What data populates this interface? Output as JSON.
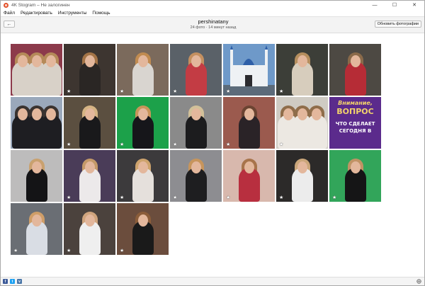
{
  "window": {
    "title": "4K Stogram – Не залогинен",
    "controls": [
      "—",
      "☐",
      "✕"
    ]
  },
  "menu": [
    "Файл",
    "Редактировать",
    "Инструменты",
    "Помощь"
  ],
  "header": {
    "back_label": "←",
    "username": "pershinatany",
    "subtitle": "24 фото · 14 минут назад",
    "update_button": "Обновить фотографии"
  },
  "photos": [
    {
      "bg": "#8c3a4b",
      "body": "#d8d1c8",
      "hair": "#b58a59",
      "star": false,
      "group": true
    },
    {
      "bg": "#3d3530",
      "body": "#2a2624",
      "hair": "#a47447",
      "star": true
    },
    {
      "bg": "#7b6a5c",
      "body": "#d9d5d0",
      "hair": "#c18b50",
      "star": true
    },
    {
      "bg": "#5a6168",
      "body": "#c33c44",
      "hair": "#c49060",
      "star": true
    },
    {
      "bg": "#6e99c9",
      "body": "#eaeef2",
      "hair": "#3f4650",
      "star": true,
      "mosque": true
    },
    {
      "bg": "#3c3e38",
      "body": "#d7cdbd",
      "hair": "#b58e5e",
      "star": true
    },
    {
      "bg": "#4d4943",
      "body": "#b62c36",
      "hair": "#8a6a4a",
      "star": false
    },
    {
      "bg": "#9aa8bb",
      "body": "#1e1e22",
      "hair": "#3a3330",
      "star": false,
      "group": true
    },
    {
      "bg": "#5b4f40",
      "body": "#19191b",
      "hair": "#d5b484",
      "star": true
    },
    {
      "bg": "#1ca14a",
      "body": "#16161a",
      "hair": "#c7955a",
      "star": true
    },
    {
      "bg": "#8a8a8a",
      "body": "#1c1c1e",
      "hair": "#d2c099",
      "star": true
    },
    {
      "bg": "#9b5a4e",
      "body": "#2a2327",
      "hair": "#6b4432",
      "star": true
    },
    {
      "bg": "#cfcbc3",
      "body": "#ece8e2",
      "hair": "#8f6d4a",
      "star": true,
      "group": true
    },
    {
      "bg": "#5b2b8c",
      "body": "#5b2b8c",
      "hair": "#5b2b8c",
      "star": false,
      "text": true
    },
    {
      "bg": "#bdbcbc",
      "body": "#141416",
      "hair": "#c9a16f",
      "star": false
    },
    {
      "bg": "#4a3c58",
      "body": "#ece9ea",
      "hair": "#c49968",
      "star": true
    },
    {
      "bg": "#3c3a3c",
      "body": "#e5e0dc",
      "hair": "#cda36d",
      "star": true
    },
    {
      "bg": "#8d8d91",
      "body": "#1e1e20",
      "hair": "#c7955c",
      "star": true
    },
    {
      "bg": "#d8b8ad",
      "body": "#b82f3f",
      "hair": "#a8744b",
      "star": true
    },
    {
      "bg": "#2c2a29",
      "body": "#ececec",
      "hair": "#caa67a",
      "star": true
    },
    {
      "bg": "#32a55a",
      "body": "#151516",
      "hair": "#c09365",
      "star": true
    },
    {
      "bg": "#6a6e74",
      "body": "#d9dde4",
      "hair": "#cf9e68",
      "star": true
    },
    {
      "bg": "#4b423d",
      "body": "#efefef",
      "hair": "#cfa47d",
      "star": true
    },
    {
      "bg": "#6b4d3d",
      "body": "#1a1a1a",
      "hair": "#8b5d3a",
      "star": true
    }
  ],
  "promo": {
    "line1": "Внимание,",
    "line2": "ВОПРОС",
    "line3": "ЧТО СДЕЛАЕТ",
    "line4": "СЕГОДНЯ В"
  },
  "footer": {
    "social": [
      {
        "name": "facebook-icon",
        "color": "#3b5998",
        "glyph": "f"
      },
      {
        "name": "twitter-icon",
        "color": "#1da1f2",
        "glyph": "t"
      },
      {
        "name": "vk-icon",
        "color": "#4a76a8",
        "glyph": "v"
      }
    ]
  }
}
